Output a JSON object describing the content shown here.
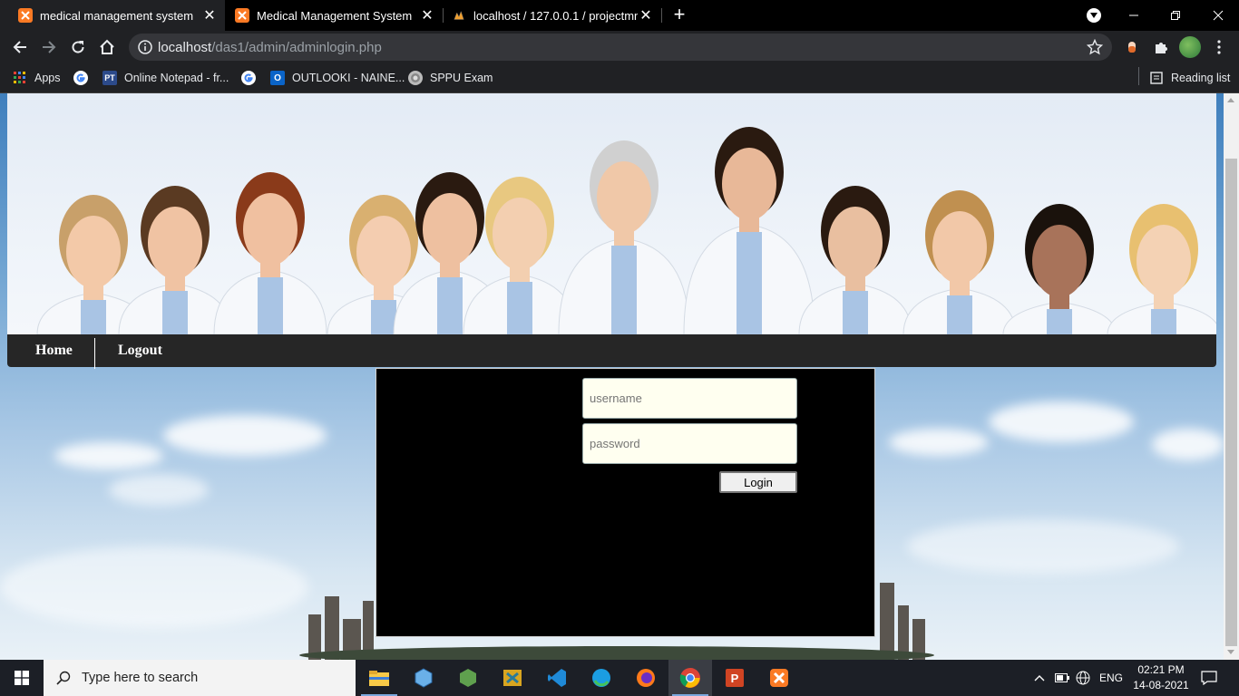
{
  "browser": {
    "tabs": [
      {
        "title": "medical management system",
        "active": true
      },
      {
        "title": "Medical Management System",
        "active": false
      },
      {
        "title": "localhost / 127.0.0.1 / projectmm",
        "active": false
      }
    ],
    "address": {
      "host": "localhost",
      "path": "/das1/admin/adminlogin.php"
    },
    "bookmarks": [
      {
        "label": "Apps"
      },
      {
        "label": ""
      },
      {
        "label": "Online Notepad - fr..."
      },
      {
        "label": ""
      },
      {
        "label": "OUTLOOKI - NAINE..."
      },
      {
        "label": "SPPU Exam"
      }
    ],
    "reading_list": "Reading list"
  },
  "page": {
    "nav": [
      {
        "label": "Home"
      },
      {
        "label": "Logout"
      }
    ],
    "login": {
      "username_placeholder": "username",
      "password_placeholder": "password",
      "button": "Login"
    }
  },
  "taskbar": {
    "search_placeholder": "Type here to search",
    "language": "ENG",
    "time": "02:21 PM",
    "date": "14-08-2021"
  },
  "colors": {
    "accent_orange": "#fb7a24",
    "nav_bg": "#262626",
    "login_bg": "#000000",
    "input_bg": "#fffff0"
  }
}
